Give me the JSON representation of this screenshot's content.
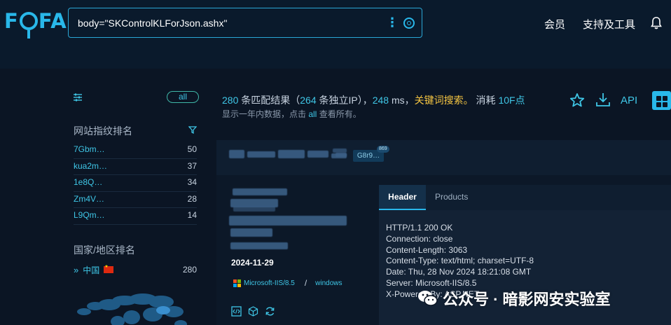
{
  "header": {
    "logo": "FOFA",
    "query": "body=\"SKControlKLForJson.ashx\"",
    "nav_member": "会员",
    "nav_tools": "支持及工具"
  },
  "sidebar": {
    "all_label": "all",
    "fingerprint_title": "网站指纹排名",
    "fingerprints": [
      {
        "name": "7Gbm…",
        "count": "50"
      },
      {
        "name": "kua2m…",
        "count": "37"
      },
      {
        "name": "1e8Q…",
        "count": "34"
      },
      {
        "name": "Zm4V…",
        "count": "28"
      },
      {
        "name": "L9Qm…",
        "count": "14"
      }
    ],
    "country_title": "国家/地区排名",
    "country": {
      "name": "中国",
      "count": "280"
    }
  },
  "summary": {
    "total": "280",
    "total_suffix": " 条匹配结果（",
    "ip_count": "264",
    "ip_suffix": " 条独立IP），",
    "ms": "248",
    "ms_suffix": " ms，",
    "keyword_search": "关键词搜索。",
    "cost_prefix": " 消耗 ",
    "cost": "10F点",
    "note_prefix": "显示一年内数据，点击 ",
    "note_all": "all",
    "note_suffix": " 查看所有。"
  },
  "toolbar": {
    "api_label": "API"
  },
  "result": {
    "tag_chip": "G8r9…",
    "tag_badge": "869",
    "date": "2024-11-29",
    "server": "Microsoft-IIS/8.5",
    "separator": "/",
    "os": "windows",
    "tabs": {
      "header": "Header",
      "products": "Products"
    },
    "http_lines": [
      "HTTP/1.1 200 OK",
      "Connection: close",
      "Content-Length: 3063",
      "Content-Type: text/html; charset=UTF-8",
      "Date: Thu, 28 Nov 2024 18:21:08 GMT",
      "Server: Microsoft-IIS/8.5",
      "X-Powered-By: ASP.NET"
    ]
  },
  "watermark": "公众号 · 暗影网安实验室",
  "colors": {
    "accent": "#29b8ea",
    "link": "#3fc6e6",
    "keyword": "#f5c542",
    "background": "#0b1524"
  }
}
